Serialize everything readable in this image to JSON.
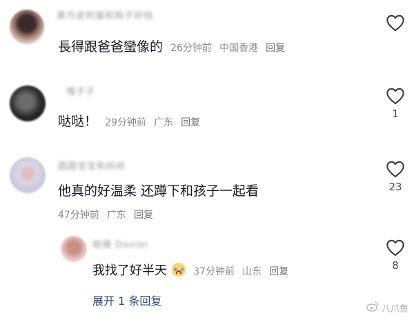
{
  "comments": [
    {
      "username": "果丹皮的猫和狗子铃铛",
      "text": "長得跟爸爸蠻像的",
      "time": "26分钟前",
      "location": "中国香港",
      "reply_label": "回复",
      "likes": ""
    },
    {
      "username": "嘎子子",
      "text": "哒哒！",
      "time": "29分钟前",
      "location": "广东",
      "reply_label": "回复",
      "likes": "1"
    },
    {
      "username": "圆圆宝宝和妈妈",
      "text": "他真的好温柔 还蹲下和孩子一起看",
      "time": "47分钟前",
      "location": "广东",
      "reply_label": "回复",
      "likes": "23"
    }
  ],
  "reply": {
    "username": "皓晴 Daniel",
    "text": "我找了好半天",
    "emoji": "crying-face-emoji",
    "time": "37分钟前",
    "location": "山东",
    "reply_label": "回复",
    "likes": "8"
  },
  "expand_label": "展开 1 条回复",
  "watermark": "八爪鱼",
  "colors": {
    "text": "#161823",
    "meta": "#8a8b91",
    "link": "#2f4b7a",
    "heart": "#3a3b42"
  }
}
